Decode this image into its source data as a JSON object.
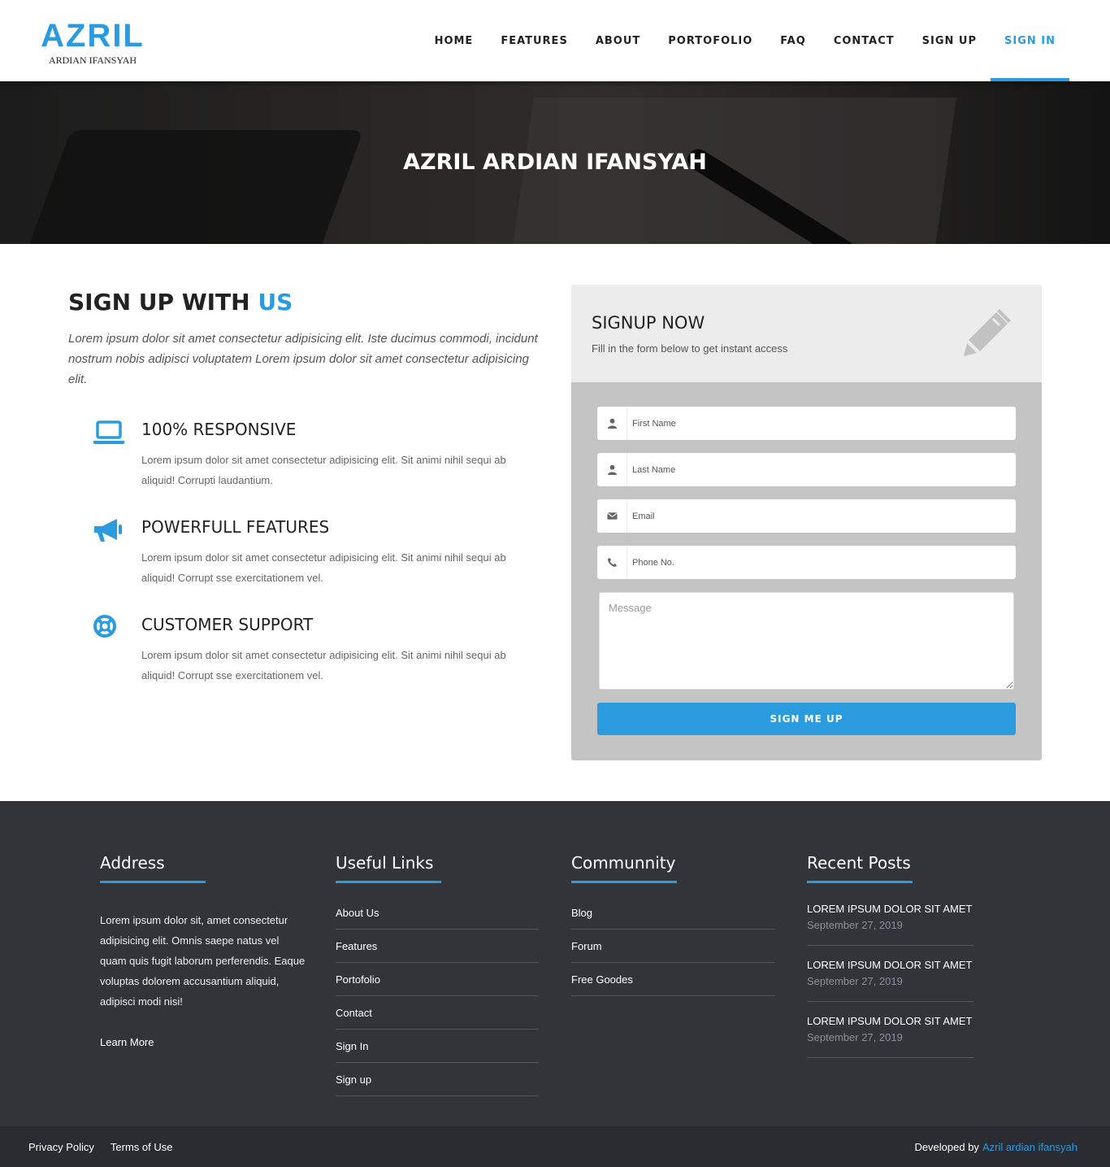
{
  "brand": {
    "title": "AZRIL",
    "subtitle": "ARDIAN IFANSYAH",
    "accent_color": "#2b9be0"
  },
  "nav": {
    "items": [
      {
        "label": "HOME"
      },
      {
        "label": "FEATURES"
      },
      {
        "label": "ABOUT"
      },
      {
        "label": "PORTOFOLIO"
      },
      {
        "label": "FAQ"
      },
      {
        "label": "CONTACT"
      },
      {
        "label": "SIGN UP"
      },
      {
        "label": "SIGN IN",
        "active": true
      }
    ]
  },
  "hero": {
    "title": "AZRIL ARDIAN IFANSYAH"
  },
  "signup_section": {
    "title_main": "SIGN UP WITH",
    "title_accent": "US",
    "intro": "Lorem ipsum dolor sit amet consectetur adipisicing elit. Iste ducimus commodi, incidunt nostrum nobis adipisci voluptatem Lorem ipsum dolor sit amet consectetur adipisicing elit.",
    "features": [
      {
        "icon": "laptop-icon",
        "title": "100% RESPONSIVE",
        "text": "Lorem ipsum dolor sit amet consectetur adipisicing elit. Sit animi nihil sequi ab aliquid! Corrupti laudantium."
      },
      {
        "icon": "megaphone-icon",
        "title": "POWERFULL FEATURES",
        "text": "Lorem ipsum dolor sit amet consectetur adipisicing elit. Sit animi nihil sequi ab aliquid! Corrupt sse exercitationem vel."
      },
      {
        "icon": "lifebuoy-icon",
        "title": "CUSTOMER SUPPORT",
        "text": "Lorem ipsum dolor sit amet consectetur adipisicing elit. Sit animi nihil sequi ab aliquid! Corrupt sse exercitationem vel."
      }
    ]
  },
  "form": {
    "title": "SIGNUP NOW",
    "subtitle": "Fill in the form below to get instant access",
    "first_name_placeholder": "First Name",
    "last_name_placeholder": "Last Name",
    "email_placeholder": "Email",
    "phone_placeholder": "Phone No.",
    "message_placeholder": "Message",
    "submit_label": "SIGN ME UP"
  },
  "footer": {
    "address": {
      "title": "Address",
      "text": "Lorem ipsum dolor sit, amet consectetur adipisicing elit. Omnis saepe natus vel quam quis fugit laborum perferendis. Eaque voluptas dolorem accusantium aliquid, adipisci modi nisi!",
      "learn_more": "Learn More"
    },
    "useful_links": {
      "title": "Useful Links",
      "items": [
        "About Us",
        "Features",
        "Portofolio",
        "Contact",
        "Sign In",
        "Sign up"
      ]
    },
    "community": {
      "title": "Communnity",
      "items": [
        "Blog",
        "Forum",
        "Free Goodes"
      ]
    },
    "recent_posts": {
      "title": "Recent Posts",
      "items": [
        {
          "title": "LOREM IPSUM DOLOR SIT AMET",
          "date": "September 27, 2019"
        },
        {
          "title": "LOREM IPSUM DOLOR SIT AMET",
          "date": "September 27, 2019"
        },
        {
          "title": "LOREM IPSUM DOLOR SIT AMET",
          "date": "September 27, 2019"
        }
      ]
    }
  },
  "bottom_bar": {
    "privacy": "Privacy Policy",
    "terms": "Terms of Use",
    "credit_prefix": "Developed by",
    "credit_name": "Azril ardian ifansyah"
  }
}
